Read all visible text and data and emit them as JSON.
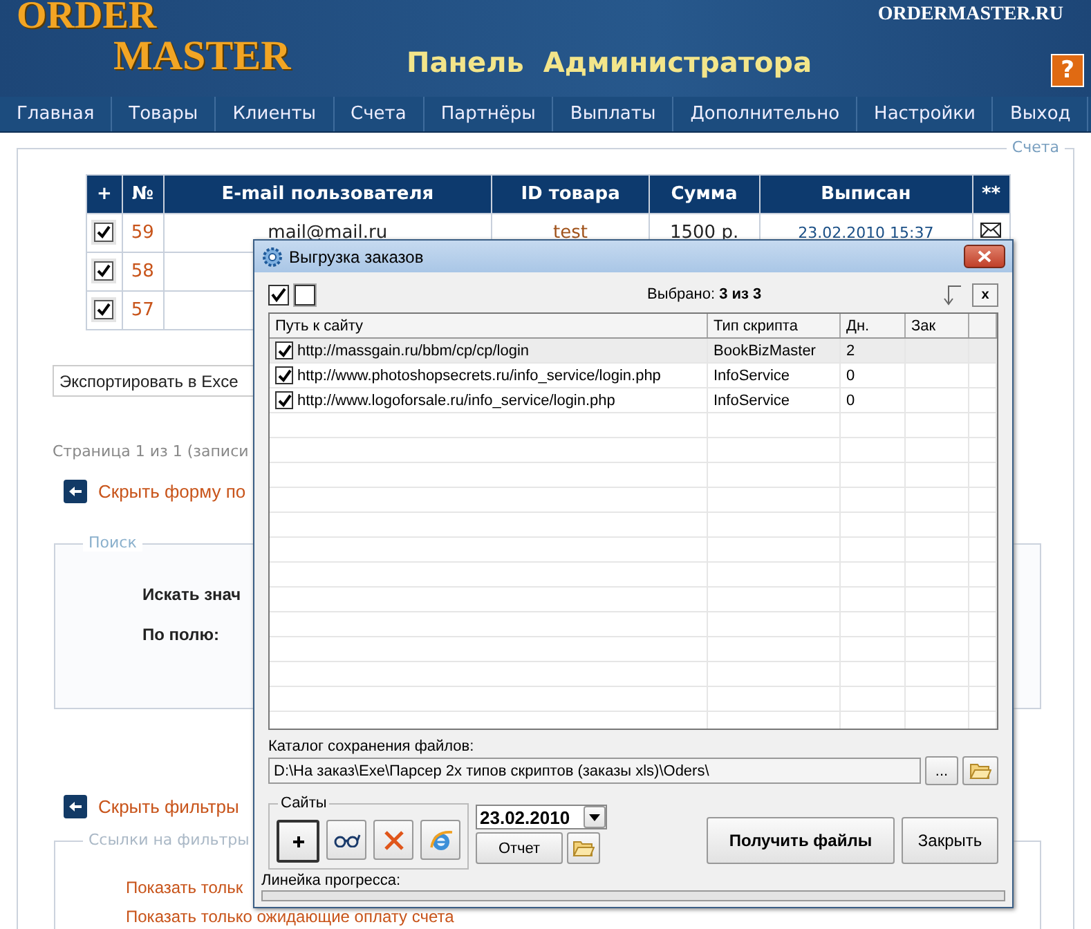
{
  "header": {
    "logo_top": "ORDER",
    "logo_bottom": "MASTER",
    "site": "ORDERMASTER.RU",
    "title": "Панель  Администратора",
    "help": "?"
  },
  "nav": [
    "Главная",
    "Товары",
    "Клиенты",
    "Счета",
    "Партнёры",
    "Выплаты",
    "Дополнительно",
    "Настройки",
    "Выход"
  ],
  "section_legend": "Счета",
  "table": {
    "columns": [
      "+",
      "№",
      "E-mail пользователя",
      "ID товара",
      "Сумма",
      "Выписан",
      "**"
    ],
    "rows": [
      {
        "checked": true,
        "number": "59",
        "email": "mail@mail.ru",
        "product_id": "test",
        "sum": "1500 р.",
        "issued": "23.02.2010 15:37",
        "kind": "mail"
      },
      {
        "checked": true,
        "number": "58"
      },
      {
        "checked": true,
        "number": "57"
      }
    ]
  },
  "export_select": "Экспортировать в Exce",
  "pagination": "Страница 1 из 1 (записи",
  "hide_search_link": "Скрыть форму по",
  "search": {
    "legend": "Поиск",
    "labels": [
      "Искать знач",
      "По полю:"
    ]
  },
  "hide_filters_link": "Скрыть фильтры",
  "filters": {
    "legend": "Ссылки на фильтры",
    "links": [
      "Показать тольк",
      "Показать только ожидающие оплату счета"
    ]
  },
  "dialog": {
    "title": "Выгрузка заказов",
    "selected_info": "Выбрано: **3 из 3**",
    "clear_button": "x",
    "columns": [
      "Путь к сайту",
      "Тип скрипта",
      "Дн.",
      "Зак"
    ],
    "rows": [
      {
        "checked": true,
        "selected": true,
        "url": "http://massgain.ru/bbm/cp/cp/login",
        "script_type": "BookBizMaster",
        "days": "2"
      },
      {
        "checked": true,
        "selected": false,
        "url": "http://www.photoshopsecrets.ru/info_service/login.php",
        "script_type": "InfoService",
        "days": "0"
      },
      {
        "checked": true,
        "selected": false,
        "url": "http://www.logoforsale.ru/info_service/login.php",
        "script_type": "InfoService",
        "days": "0"
      }
    ],
    "folder_label": "Каталог сохранения файлов:",
    "folder_path": "D:\\На заказ\\Exe\\Парсер 2х типов скриптов (заказы xls)\\Oders\\",
    "browse_button": "...",
    "sites_legend": "Сайты",
    "date": "23.02.2010",
    "report_button": "Отчет",
    "get_button": "Получить файлы",
    "close_button": "Закрыть",
    "progress_label": "Линейка прогресса:",
    "progress": {
      "level": 0
    }
  }
}
